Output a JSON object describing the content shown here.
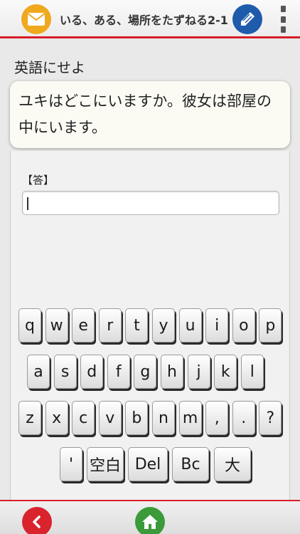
{
  "header": {
    "title": "いる、ある、場所をたずねる2-1",
    "mail_icon": "envelope-icon",
    "pencil_icon": "pencil-icon",
    "more_icon": "more-vertical-icon",
    "accent_color": "#d81e2a"
  },
  "instruction": "英語にせよ",
  "question": {
    "line1": "ユキはどこにいますか。彼女は部屋の",
    "line2": "中にいます。"
  },
  "answer": {
    "label": "【答】",
    "value": ""
  },
  "keyboard": {
    "row1": [
      "q",
      "w",
      "e",
      "r",
      "t",
      "y",
      "u",
      "i",
      "o",
      "p"
    ],
    "row2": [
      "a",
      "s",
      "d",
      "f",
      "g",
      "h",
      "j",
      "k",
      "l"
    ],
    "row3": [
      "z",
      "x",
      "c",
      "v",
      "b",
      "n",
      "m",
      ",",
      ".",
      "?"
    ],
    "row4": [
      "'",
      "空白",
      "Del",
      "Bc",
      "大"
    ]
  },
  "footer": {
    "back_icon": "chevron-left-icon",
    "home_icon": "home-icon"
  }
}
